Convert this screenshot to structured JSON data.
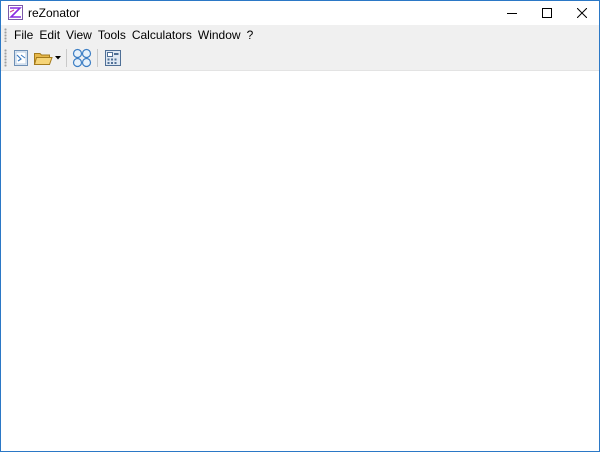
{
  "window": {
    "title": "reZonator"
  },
  "menubar": {
    "items": [
      {
        "label": "File"
      },
      {
        "label": "Edit"
      },
      {
        "label": "View"
      },
      {
        "label": "Tools"
      },
      {
        "label": "Calculators"
      },
      {
        "label": "Window"
      },
      {
        "label": "?"
      }
    ]
  },
  "toolbar": {
    "buttons": [
      {
        "icon": "new-schema-icon"
      },
      {
        "icon": "open-folder-icon"
      },
      {
        "icon": "dropdown-arrow-icon"
      },
      {
        "icon": "lens-group-icon"
      },
      {
        "icon": "calculator-icon"
      }
    ]
  },
  "colors": {
    "window_border": "#2b78c6",
    "bar_background": "#f0f0f0",
    "workspace": "#ffffff"
  }
}
